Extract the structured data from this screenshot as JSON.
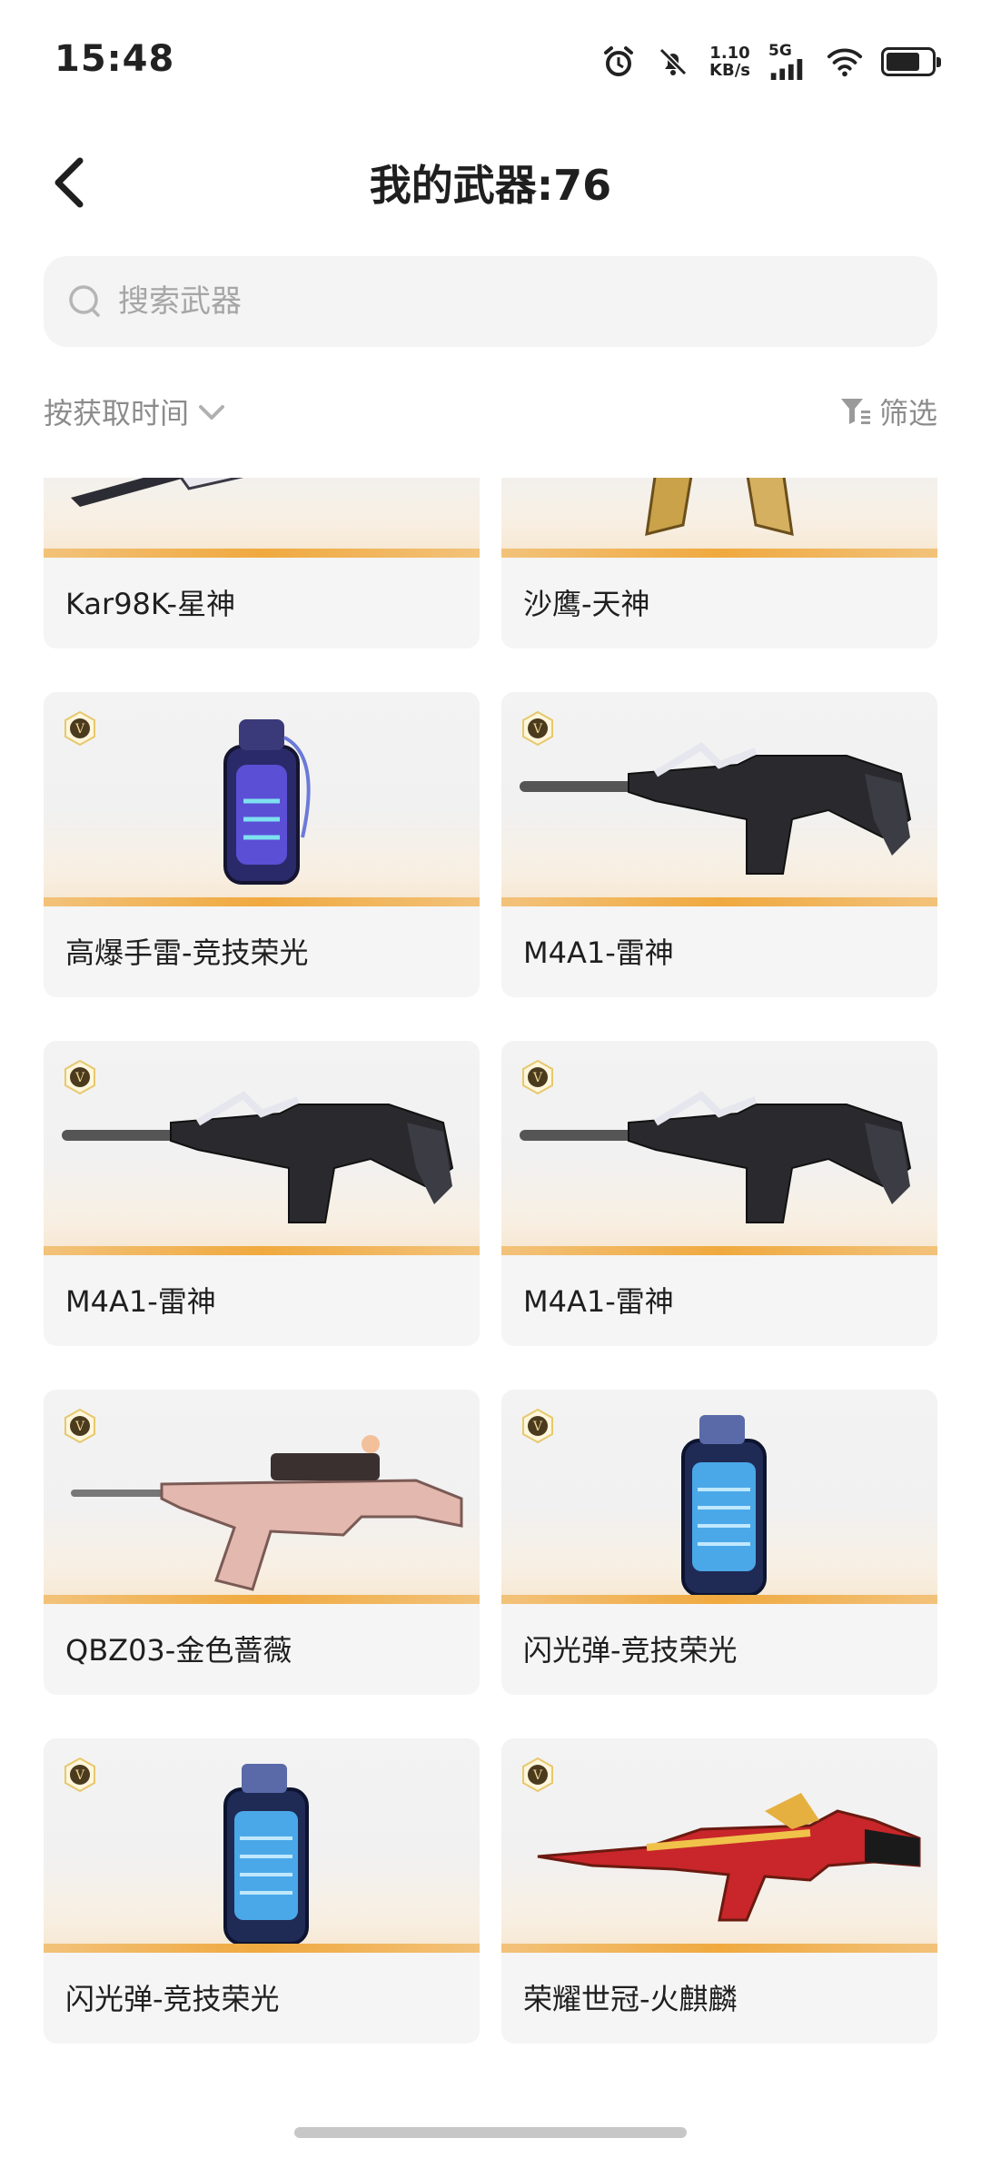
{
  "status_bar": {
    "time": "15:48",
    "net_speed_value": "1.10",
    "net_speed_unit": "KB/s",
    "network_type": "5G",
    "icons": [
      "alarm-icon",
      "mute-bell-icon",
      "signal-icon",
      "wifi-icon",
      "battery-icon"
    ],
    "battery_level": 0.75
  },
  "header": {
    "title": "我的武器:76",
    "back_icon": "chevron-left-icon"
  },
  "search": {
    "placeholder": "搜索武器",
    "value": ""
  },
  "sort": {
    "label": "按获取时间",
    "icon": "chevron-down-icon"
  },
  "filter": {
    "label": "筛选",
    "icon": "filter-icon"
  },
  "weapons": [
    {
      "name": "Kar98K-星神",
      "type": "sniper"
    },
    {
      "name": "沙鹰-天神",
      "type": "pistols"
    },
    {
      "name": "高爆手雷-竞技荣光",
      "type": "grenade"
    },
    {
      "name": "M4A1-雷神",
      "type": "rifle"
    },
    {
      "name": "M4A1-雷神",
      "type": "rifle"
    },
    {
      "name": "M4A1-雷神",
      "type": "rifle"
    },
    {
      "name": "QBZ03-金色蔷薇",
      "type": "rifle-pink"
    },
    {
      "name": "闪光弹-竞技荣光",
      "type": "flashbang"
    },
    {
      "name": "闪光弹-竞技荣光",
      "type": "flashbang"
    },
    {
      "name": "荣耀世冠-火麒麟",
      "type": "ak-gold"
    }
  ],
  "colors": {
    "accent_bar": "#f0a93f",
    "card_bg": "#f5f5f5",
    "muted_text": "#8c8c8c"
  }
}
